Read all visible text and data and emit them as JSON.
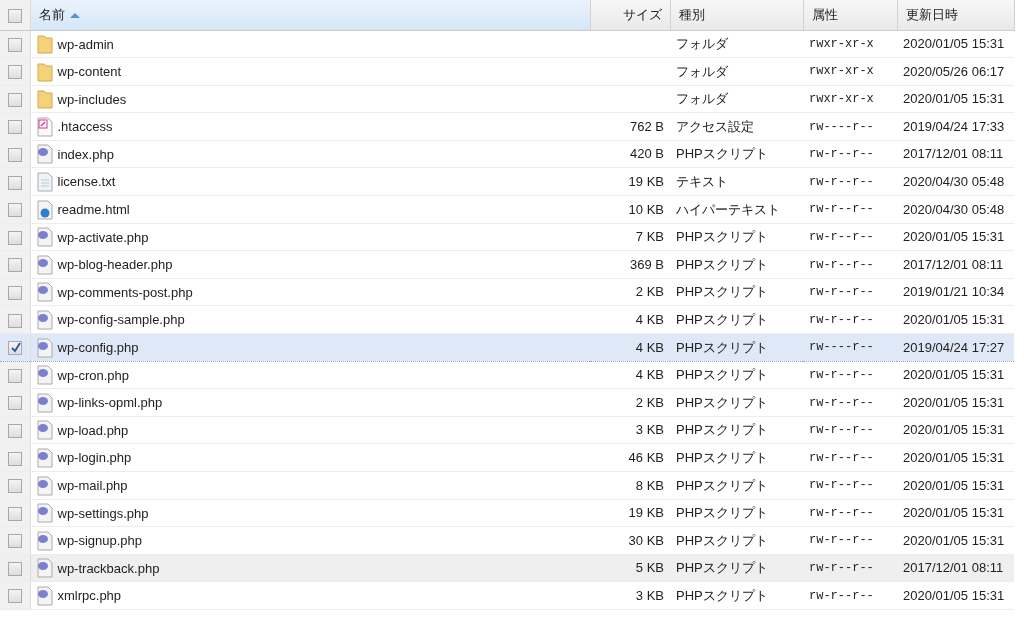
{
  "columns": [
    {
      "label": "名前",
      "sorted": true
    },
    {
      "label": "サイズ",
      "sorted": false
    },
    {
      "label": "種別",
      "sorted": false
    },
    {
      "label": "属性",
      "sorted": false
    },
    {
      "label": "更新日時",
      "sorted": false
    }
  ],
  "select_all_checked": false,
  "rows": [
    {
      "kind": "folder",
      "name": "wp-admin",
      "size": "",
      "type": "フォルダ",
      "attributes": "rwxr-xr-x",
      "modified": "2020/01/05 15:31",
      "checked": false,
      "selected": false,
      "hovered": false
    },
    {
      "kind": "folder",
      "name": "wp-content",
      "size": "",
      "type": "フォルダ",
      "attributes": "rwxr-xr-x",
      "modified": "2020/05/26 06:17",
      "checked": false,
      "selected": false,
      "hovered": false
    },
    {
      "kind": "folder",
      "name": "wp-includes",
      "size": "",
      "type": "フォルダ",
      "attributes": "rwxr-xr-x",
      "modified": "2020/01/05 15:31",
      "checked": false,
      "selected": false,
      "hovered": false
    },
    {
      "kind": "config",
      "name": ".htaccess",
      "size": "762 B",
      "type": "アクセス設定",
      "attributes": "rw----r--",
      "modified": "2019/04/24 17:33",
      "checked": false,
      "selected": false,
      "hovered": false
    },
    {
      "kind": "php",
      "name": "index.php",
      "size": "420 B",
      "type": "PHPスクリプト",
      "attributes": "rw-r--r--",
      "modified": "2017/12/01 08:11",
      "checked": false,
      "selected": false,
      "hovered": false
    },
    {
      "kind": "text",
      "name": "license.txt",
      "size": "19 KB",
      "type": "テキスト",
      "attributes": "rw-r--r--",
      "modified": "2020/04/30 05:48",
      "checked": false,
      "selected": false,
      "hovered": false
    },
    {
      "kind": "html",
      "name": "readme.html",
      "size": "10 KB",
      "type": "ハイパーテキスト",
      "attributes": "rw-r--r--",
      "modified": "2020/04/30 05:48",
      "checked": false,
      "selected": false,
      "hovered": false
    },
    {
      "kind": "php",
      "name": "wp-activate.php",
      "size": "7 KB",
      "type": "PHPスクリプト",
      "attributes": "rw-r--r--",
      "modified": "2020/01/05 15:31",
      "checked": false,
      "selected": false,
      "hovered": false
    },
    {
      "kind": "php",
      "name": "wp-blog-header.php",
      "size": "369 B",
      "type": "PHPスクリプト",
      "attributes": "rw-r--r--",
      "modified": "2017/12/01 08:11",
      "checked": false,
      "selected": false,
      "hovered": false
    },
    {
      "kind": "php",
      "name": "wp-comments-post.php",
      "size": "2 KB",
      "type": "PHPスクリプト",
      "attributes": "rw-r--r--",
      "modified": "2019/01/21 10:34",
      "checked": false,
      "selected": false,
      "hovered": false
    },
    {
      "kind": "php",
      "name": "wp-config-sample.php",
      "size": "4 KB",
      "type": "PHPスクリプト",
      "attributes": "rw-r--r--",
      "modified": "2020/01/05 15:31",
      "checked": false,
      "selected": false,
      "hovered": false
    },
    {
      "kind": "php",
      "name": "wp-config.php",
      "size": "4 KB",
      "type": "PHPスクリプト",
      "attributes": "rw----r--",
      "modified": "2019/04/24 17:27",
      "checked": true,
      "selected": true,
      "hovered": false
    },
    {
      "kind": "php",
      "name": "wp-cron.php",
      "size": "4 KB",
      "type": "PHPスクリプト",
      "attributes": "rw-r--r--",
      "modified": "2020/01/05 15:31",
      "checked": false,
      "selected": false,
      "hovered": false
    },
    {
      "kind": "php",
      "name": "wp-links-opml.php",
      "size": "2 KB",
      "type": "PHPスクリプト",
      "attributes": "rw-r--r--",
      "modified": "2020/01/05 15:31",
      "checked": false,
      "selected": false,
      "hovered": false
    },
    {
      "kind": "php",
      "name": "wp-load.php",
      "size": "3 KB",
      "type": "PHPスクリプト",
      "attributes": "rw-r--r--",
      "modified": "2020/01/05 15:31",
      "checked": false,
      "selected": false,
      "hovered": false
    },
    {
      "kind": "php",
      "name": "wp-login.php",
      "size": "46 KB",
      "type": "PHPスクリプト",
      "attributes": "rw-r--r--",
      "modified": "2020/01/05 15:31",
      "checked": false,
      "selected": false,
      "hovered": false
    },
    {
      "kind": "php",
      "name": "wp-mail.php",
      "size": "8 KB",
      "type": "PHPスクリプト",
      "attributes": "rw-r--r--",
      "modified": "2020/01/05 15:31",
      "checked": false,
      "selected": false,
      "hovered": false
    },
    {
      "kind": "php",
      "name": "wp-settings.php",
      "size": "19 KB",
      "type": "PHPスクリプト",
      "attributes": "rw-r--r--",
      "modified": "2020/01/05 15:31",
      "checked": false,
      "selected": false,
      "hovered": false
    },
    {
      "kind": "php",
      "name": "wp-signup.php",
      "size": "30 KB",
      "type": "PHPスクリプト",
      "attributes": "rw-r--r--",
      "modified": "2020/01/05 15:31",
      "checked": false,
      "selected": false,
      "hovered": false
    },
    {
      "kind": "php",
      "name": "wp-trackback.php",
      "size": "5 KB",
      "type": "PHPスクリプト",
      "attributes": "rw-r--r--",
      "modified": "2017/12/01 08:11",
      "checked": false,
      "selected": false,
      "hovered": true
    },
    {
      "kind": "php",
      "name": "xmlrpc.php",
      "size": "3 KB",
      "type": "PHPスクリプト",
      "attributes": "rw-r--r--",
      "modified": "2020/01/05 15:31",
      "checked": false,
      "selected": false,
      "hovered": false
    }
  ]
}
